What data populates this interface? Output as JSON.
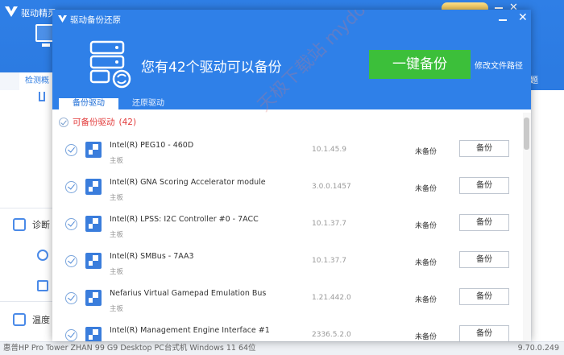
{
  "background_app": {
    "title": "驱动精灵",
    "tab_left": "检测概",
    "tab_right": "题",
    "side_items": [
      {
        "label": "诊断"
      },
      {
        "label": "温度"
      }
    ],
    "footer": {
      "system": "惠普HP Pro Tower ZHAN 99 G9 Desktop PC台式机   Windows 11 64位",
      "version": "9.70.0.249"
    }
  },
  "dialog": {
    "title": "驱动备份还原",
    "hero_text": "您有42个驱动可以备份",
    "backup_all_label": "一键备份",
    "change_path_label": "修改文件路径",
    "tabs": [
      {
        "label": "备份驱动",
        "active": true
      },
      {
        "label": "还原驱动",
        "active": false
      }
    ],
    "section": {
      "label": "可备份驱动",
      "count": "(42)"
    },
    "watermark": "天极下载站 mydown.yesky.com",
    "rows": [
      {
        "name": "Intel(R) PEG10 - 460D",
        "category": "主板",
        "version": "10.1.45.9",
        "status": "未备份",
        "button": "备份"
      },
      {
        "name": "Intel(R) GNA Scoring Accelerator module",
        "category": "主板",
        "version": "3.0.0.1457",
        "status": "未备份",
        "button": "备份"
      },
      {
        "name": "Intel(R) LPSS: I2C Controller #0 - 7ACC",
        "category": "主板",
        "version": "10.1.37.7",
        "status": "未备份",
        "button": "备份"
      },
      {
        "name": "Intel(R) SMBus - 7AA3",
        "category": "主板",
        "version": "10.1.37.7",
        "status": "未备份",
        "button": "备份"
      },
      {
        "name": "Nefarius Virtual Gamepad Emulation Bus",
        "category": "主板",
        "version": "1.21.442.0",
        "status": "未备份",
        "button": "备份"
      },
      {
        "name": "Intel(R) Management Engine Interface #1",
        "category": "",
        "version": "2336.5.2.0",
        "status": "未备份",
        "button": "备份"
      }
    ]
  },
  "colors": {
    "accent_blue": "#2f80e8",
    "green_button": "#3cbf3a",
    "red_section": "#e23b3b"
  }
}
